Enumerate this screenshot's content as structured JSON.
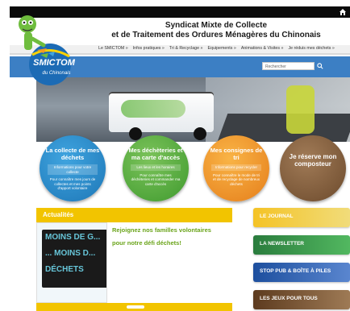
{
  "header": {
    "title_line1": "Syndicat Mixte de Collecte",
    "title_line2": "et de Traitement des Ordures Ménagères du Chinonais"
  },
  "logo": {
    "brand": "SMICTOM",
    "sub": "du Chinonais"
  },
  "nav": {
    "items": [
      "Le SMICTOM »",
      "Infos pratiques »",
      "Tri & Recyclage »",
      "Equipements »",
      "Animations & Visites »",
      "Je réduis mes déchets »"
    ]
  },
  "search": {
    "placeholder": "Rechercher"
  },
  "circles": [
    {
      "title": "La collecte de mes déchets",
      "sub": "Informations pour votre collecte",
      "desc": "Pour connaître mes jours de collectes et mes points d'apport volontaire"
    },
    {
      "title": "Mes déchèteries et ma carte d'accès",
      "sub": "Les lieux et les horaires",
      "desc": "Pour connaître mes déchèteries et commander ma carte d'accès"
    },
    {
      "title": "Mes consignes de tri",
      "sub": "Informations pour recycler",
      "desc": "Pour connaître le mode de tri et de recyclage de nombreux déchets"
    },
    {
      "title": "Je réserve mon composteur"
    }
  ],
  "news": {
    "label": "Actualités",
    "image_lines": [
      "MOINS DE G...",
      "... MOINS D...",
      "DÉCHETS"
    ],
    "headline": "Rejoignez nos familles volontaires pour notre défi déchets!"
  },
  "side": [
    "LE JOURNAL",
    "LA NEWSLETTER",
    "STOP PUB & BOÎTE À PILES",
    "LES JEUX POUR TOUS"
  ],
  "colors": {
    "blue": "#3c7fc4",
    "green": "#3f9a2e",
    "orange": "#e57e1b",
    "brown": "#6c4a2c",
    "yellow": "#f2c400"
  }
}
